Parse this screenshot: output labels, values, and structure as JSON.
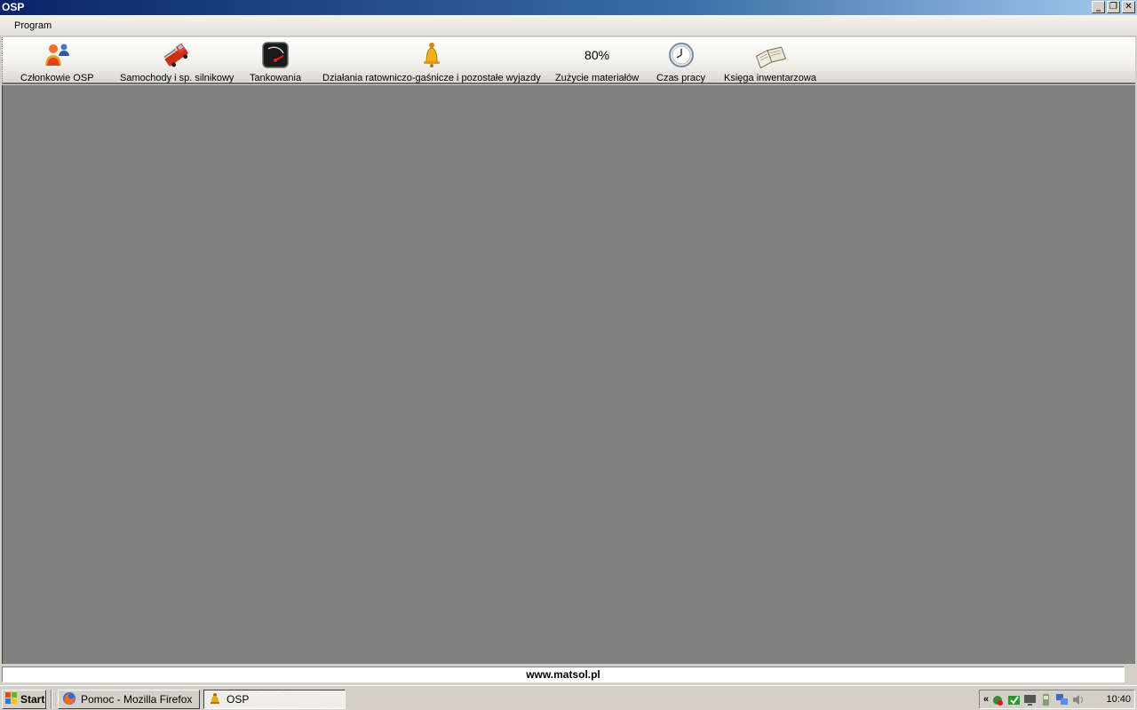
{
  "window": {
    "title": "OSP",
    "controls": [
      "_",
      "❐",
      "✕"
    ]
  },
  "menu": {
    "program": "Program"
  },
  "toolbar": {
    "members": "Członkowie OSP",
    "vehicles": "Samochody i sp. silnikowy",
    "refueling": "Tankowania",
    "actions": "Działania ratowniczo-gaśnicze i pozostałe wyjazdy",
    "materials_percent": "80%",
    "materials": "Zużycie materiałów",
    "worktime": "Czas pracy",
    "inventory": "Księga inwentarzowa"
  },
  "statusbar": {
    "text": "www.matsol.pl"
  },
  "taskbar": {
    "start": "Start",
    "tasks": [
      {
        "label": "Pomoc - Mozilla Firefox",
        "active": false
      },
      {
        "label": "OSP",
        "active": true
      }
    ],
    "tray_chevron": "«",
    "clock": "10:40"
  }
}
